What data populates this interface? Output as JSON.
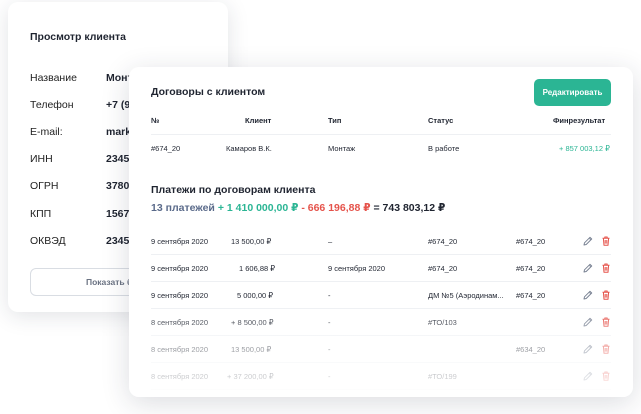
{
  "client": {
    "title": "Просмотр клиента",
    "fields": [
      {
        "label": "Название",
        "value": "Монт"
      },
      {
        "label": "Телефон",
        "value": "+7 (9"
      },
      {
        "label": "E-mail:",
        "value": "mark"
      },
      {
        "label": "ИНН",
        "value": "2345"
      },
      {
        "label": "ОГРН",
        "value": "3780"
      },
      {
        "label": "КПП",
        "value": "1567"
      },
      {
        "label": "ОКВЭД",
        "value": "2345"
      }
    ],
    "show_button": "Показать б"
  },
  "contracts": {
    "title": "Договоры с клиентом",
    "edit_button": "Редактировать",
    "headers": {
      "num": "№",
      "client": "Клиент",
      "type": "Тип",
      "status": "Статус",
      "result": "Финрезультат"
    },
    "row": {
      "num": "#674_20",
      "client": "Камаров В.К.",
      "type": "Монтаж",
      "status": "В работе",
      "result": "+ 857 003,12 ₽"
    }
  },
  "payments": {
    "title": "Платежи по договорам клиента",
    "summary": {
      "count": "13 платежей",
      "plus": "+ 1 410 000,00 ₽",
      "minus": "- 666 196,88 ₽",
      "equals": "= 743 803,12 ₽"
    },
    "rows": [
      {
        "date": "9 сентября 2020",
        "amount": "13 500,00 ₽",
        "col3": "–",
        "col4": "#674_20",
        "col5": "#674_20"
      },
      {
        "date": "9 сентября 2020",
        "amount": "1 606,88 ₽",
        "col3": "9 сентября 2020",
        "col4": "#674_20",
        "col5": "#674_20"
      },
      {
        "date": "9 сентября 2020",
        "amount": "5 000,00 ₽",
        "col3": "-",
        "col4": "ДМ №5 (Аэродинам...",
        "col5": "#674_20"
      },
      {
        "date": "8 сентября 2020",
        "amount": "+ 8 500,00 ₽",
        "col3": "-",
        "col4": "#ТО/103",
        "col5": ""
      },
      {
        "date": "8 сентября 2020",
        "amount": "13 500,00 ₽",
        "col3": "-",
        "col4": "",
        "col5": "#634_20"
      },
      {
        "date": "8 сентября 2020",
        "amount": "+ 37 200,00 ₽",
        "col3": "-",
        "col4": "#ТО/199",
        "col5": ""
      }
    ]
  },
  "colors": {
    "accent": "#2bb594",
    "negative": "#e5534b",
    "muted": "#5a6a8a"
  },
  "icons": {
    "edit": "pencil-icon",
    "delete": "trash-icon"
  }
}
